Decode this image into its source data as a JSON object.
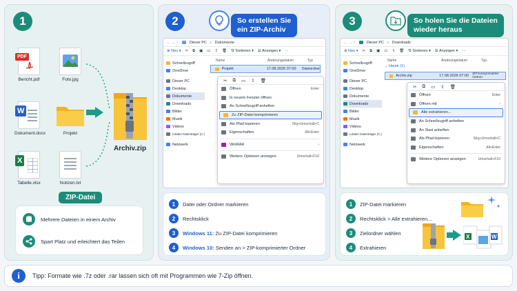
{
  "colors": {
    "green": "#1c8c78",
    "blue": "#1f5fcf",
    "accent_orange": "#f5b82a"
  },
  "panel1": {
    "number": "1",
    "files": [
      {
        "label": "Bericht.pdf",
        "badge": "PDF",
        "icon": "pdf-icon"
      },
      {
        "label": "Foto.jpg",
        "icon": "image-icon"
      },
      {
        "label": "Dokument.docx",
        "badge": "W",
        "icon": "word-icon"
      },
      {
        "label": "Projekt",
        "icon": "folder-icon"
      },
      {
        "label": "Tabelle.xlsx",
        "badge": "X",
        "icon": "excel-icon"
      },
      {
        "label": "Notizen.txt",
        "icon": "text-file-icon"
      }
    ],
    "zip_label": "Archiv.zip",
    "section_title": "ZIP-Datei",
    "features": [
      "Mehrere Dateien in einem Archiv",
      "Spart Platz und erleichtert das Teilen"
    ]
  },
  "panel2": {
    "number": "2",
    "title_line1": "So erstellen Sie",
    "title_line2": "ein ZIP-Archiv",
    "explorer": {
      "path_root": "Dieser PC",
      "path_folder": "Dokumente",
      "new": "Neu",
      "sort": "Sortieren",
      "view": "Anzeigen",
      "sidebar": [
        "Schnellzugriff",
        "OneDrive",
        "Dieser PC",
        "Desktop",
        "Dokumente",
        "Downloads",
        "Bilder",
        "Musik",
        "Videos",
        "Lokaler Datenträger (C:)",
        "Netzwerk"
      ],
      "col_name": "Name",
      "col_date": "Änderungsdatum",
      "col_type": "Typ",
      "selected": {
        "name": "Projekt",
        "date": "17.08.2026 07:00",
        "type": "Dateiordner"
      },
      "menu": [
        {
          "label": "Öffnen",
          "shortcut": "Enter"
        },
        {
          "label": "In neuem Fenster öffnen",
          "shortcut": ""
        },
        {
          "label": "An Schnellzugriff anheften",
          "shortcut": ""
        },
        {
          "label": "Zu ZIP-Datei komprimieren",
          "shortcut": ""
        },
        {
          "label": "Als Pfad kopieren",
          "shortcut": "Strg+Umschalt+C"
        },
        {
          "label": "Eigenschaften",
          "shortcut": "Alt+Enter"
        },
        {
          "label": "WinRAR",
          "shortcut": ""
        },
        {
          "label": "Weitere Optionen anzeigen",
          "shortcut": "Umschalt+F10"
        }
      ]
    },
    "steps": [
      {
        "n": "1",
        "prefix": "",
        "text": "Datei oder Ordner markieren"
      },
      {
        "n": "2",
        "prefix": "",
        "text": "Rechtsklick"
      },
      {
        "n": "3",
        "prefix": "Windows 11:",
        "text": " Zu ZIP-Datei komprimieren"
      },
      {
        "n": "4",
        "prefix": "Windows 10:",
        "text": " Senden an > ZIP-komprimierter Ordner"
      }
    ]
  },
  "panel3": {
    "number": "3",
    "title_line1": "So holen Sie die Dateien",
    "title_line2": "wieder heraus",
    "explorer": {
      "path_root": "Dieser PC",
      "path_folder": "Downloads",
      "new": "Neu",
      "sort": "Sortieren",
      "view": "Anzeigen",
      "sidebar": [
        "Schnellzugriff",
        "OneDrive",
        "Dieser PC",
        "Desktop",
        "Dokumente",
        "Downloads",
        "Bilder",
        "Musik",
        "Videos",
        "Lokaler Datenträger (C:)",
        "Netzwerk"
      ],
      "col_name": "Name",
      "col_date": "Änderungsdatum",
      "col_type": "Typ",
      "group": "Heute (1)",
      "selected": {
        "name": "Archiv.zip",
        "date": "17.08.2026 07:00",
        "type": "ZIP-komprimierter Ordner"
      },
      "menu": [
        {
          "label": "Öffnen",
          "shortcut": "Enter"
        },
        {
          "label": "Öffnen mit",
          "shortcut": ""
        },
        {
          "label": "Alle extrahieren...",
          "shortcut": ""
        },
        {
          "label": "An Schnellzugriff anheften",
          "shortcut": ""
        },
        {
          "label": "An Start anheften",
          "shortcut": ""
        },
        {
          "label": "Als Pfad kopieren",
          "shortcut": "Strg+Umschalt+C"
        },
        {
          "label": "Eigenschaften",
          "shortcut": "Alt+Enter"
        },
        {
          "label": "Weitere Optionen anzeigen",
          "shortcut": "Umschalt+F10"
        }
      ]
    },
    "steps": [
      {
        "n": "1",
        "text": "ZIP-Datei markieren"
      },
      {
        "n": "2",
        "text": "Rechtsklick > Alle extrahieren..."
      },
      {
        "n": "3",
        "text": "Zielordner wählen"
      },
      {
        "n": "4",
        "text": "Extrahieren"
      }
    ]
  },
  "tip": {
    "text": "Tipp: Formate wie .7z oder .rar lassen sich oft mit Programmen wie 7-Zip öffnen."
  }
}
